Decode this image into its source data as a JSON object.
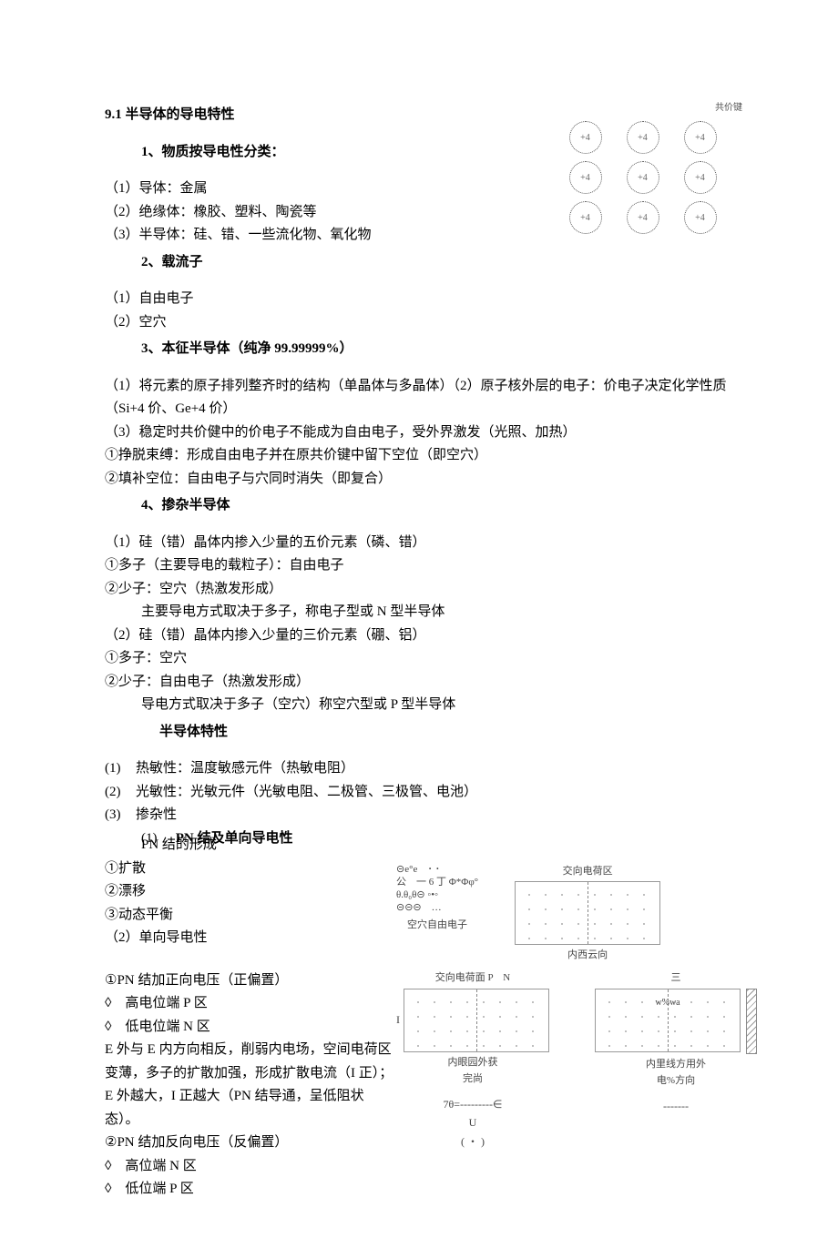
{
  "h1": "9.1 半导体的导电特性",
  "s1": {
    "title": "1、物质按导电性分类：",
    "i1": "（1）导体：金属",
    "i2": "（2）绝缘体：橡胶、塑料、陶瓷等",
    "i3": "（3）半导体：硅、错、一些流化物、氧化物"
  },
  "s2": {
    "title": "2、载流子",
    "i1": "（1）自由电子",
    "i2": "（2）空穴"
  },
  "s3": {
    "title": "3、本征半导体（纯净 99.99999%）",
    "p1": "（1）将元素的原子排列整齐时的结构（单晶体与多晶体）（2）原子核外层的电子：价电子决定化学性质（Si+4 价、Ge+4 价）",
    "p2": "（3）稳定时共价健中的价电子不能成为自由电子，受外界激发（光照、加热）",
    "p3": "①挣脱束缚：形成自由电子并在原共价键中留下空位（即空穴）",
    "p4": "②填补空位：自由电子与穴同时消失（即复合）"
  },
  "s4": {
    "title": "4、掺杂半导体",
    "a1": "（1）硅（错）晶体内掺入少量的五价元素（磷、错）",
    "a2": "①多子（主要导电的载粒子）：自由电子",
    "a3": "②少子：空穴（热激发形成）",
    "a4": "主要导电方式取决于多子，称电子型或 N 型半导体",
    "b1": "（2）硅（错）晶体内掺入少量的三价元素（硼、铝）",
    "b2": "①多子：空穴",
    "b3": "②少子：自由电子（热激发形成）",
    "b4": "导电方式取决于多子（空穴）称空穴型或 P 型半导体"
  },
  "s5": {
    "title": "半导体特性",
    "n1": "(1)",
    "n2": "(2)",
    "n3": "(3)",
    "i1": "热敏性：温度敏感元件（热敏电阻）",
    "i2": "光敏性：光敏元件（光敏电阻、二极管、三极管、电池）",
    "i3": "掺杂性"
  },
  "s6": {
    "titleA": "PN 结及单向导电性",
    "nA": "(1)",
    "titleB": "PN 结的形成",
    "i1": "①扩散",
    "i2": "②漂移",
    "i3": "③动态平衡",
    "p2": "（2）单向导电性",
    "f1": "①PN 结加正向电压（正偏置）",
    "f2": "◊　高电位端 P 区",
    "f3": "◊　低电位端 N 区",
    "f4": "E 外与 E 内方向相反，削弱内电场，空间电荷区变薄，多子的扩散加强，形成扩散电流（I 正）；E 外越大，I 正越大（PN 结导通，呈低阻状态）。",
    "r1": "②PN 结加反向电压（反偏置）",
    "r2": "◊　高位端 N 区",
    "r3": "◊　低位端 P 区"
  },
  "fig1": {
    "bondLabel": "共价键",
    "atom": "+4"
  },
  "fig2": {
    "left_tiny": "⊝e°e　･ ･\n公　一 6 丁 Φ*Φφ°\nθ.θ₀θ⊝ ◦•◦\n⊝⊝⊝　…",
    "left_cap": "空穴自由电子",
    "right_top": "交向电荷区",
    "right_cap": "内西云向"
  },
  "fig3": {
    "left_top": "交向电荷面 P　N",
    "left_mid": "内眼园外获\n完尚",
    "left_I": "I",
    "right_top": "三",
    "right_inner": "w%wa",
    "right_mid": "内里线方用外\n电%方向",
    "eq_left": "7θ=---------∈\nU\n( ・ )",
    "eq_right": "-------"
  }
}
